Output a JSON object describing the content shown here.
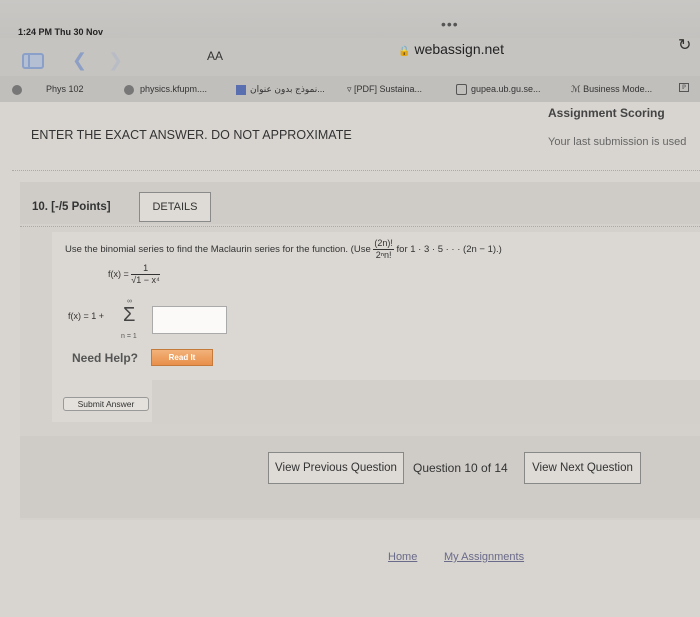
{
  "status": {
    "time_date": "1:24 PM  Thu 30 Nov",
    "dots": "•••"
  },
  "toolbar": {
    "text_size": "AA",
    "url": "webassign.net"
  },
  "bookmarks": [
    {
      "label": "Phys 102"
    },
    {
      "label": "physics.kfupm...."
    },
    {
      "label": "نموذج بدون عنوان..."
    },
    {
      "label": "[PDF] Sustaina..."
    },
    {
      "label": "gupea.ub.gu.se..."
    },
    {
      "label": "Business Mode..."
    }
  ],
  "page": {
    "instruction": "ENTER THE EXACT ANSWER. DO NOT APPROXIMATE",
    "assignment_scoring": "Assignment Scoring",
    "last_submission": "Your last submission is used"
  },
  "question": {
    "number": "10. [-/5 Points]",
    "details_label": "DETAILS",
    "prompt_prefix": "Use the binomial series to find the Maclaurin series for the function. (Use",
    "hint_num": "(2n)!",
    "hint_den": "2ⁿn!",
    "hint_suffix": "for 1 · 3 · 5 · · · (2n − 1).)",
    "func_lhs": "f(x) =",
    "func_num": "1",
    "func_den": "√1 − x⁴",
    "series_lhs": "f(x) = 1 +",
    "sigma": "Σ",
    "sigma_upper": "∞",
    "sigma_lower": "n = 1",
    "answer_value": "",
    "need_help": "Need Help?",
    "read_it": "Read It",
    "submit": "Submit Answer"
  },
  "navigation": {
    "prev": "View Previous Question",
    "counter": "Question 10 of 14",
    "next": "View Next Question"
  },
  "footer": {
    "home": "Home",
    "my_assignments": "My Assignments"
  }
}
